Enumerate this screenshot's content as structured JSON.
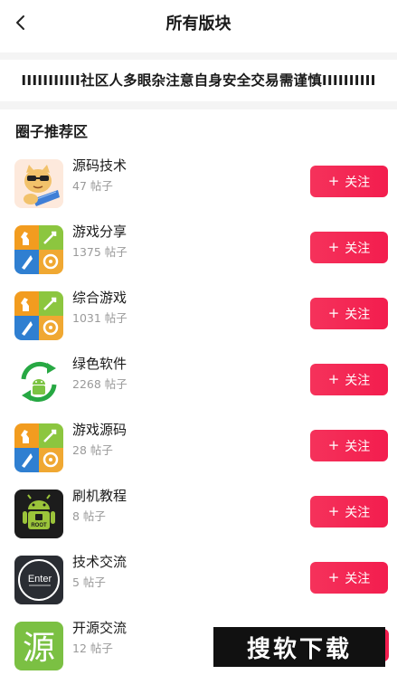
{
  "header": {
    "title": "所有版块",
    "back_icon": "chevron-left-icon"
  },
  "notice": {
    "text": "IIIIIIIIIII社区人多眼杂注意自身安全交易需谨慎IIIIIIIIII"
  },
  "section": {
    "title": "圈子推荐区"
  },
  "follow_label": "关注",
  "follow_plus": "+",
  "boards": [
    {
      "name": "源码技术",
      "count": "47 帖子",
      "icon": "cartoon-cat-laptop-icon"
    },
    {
      "name": "游戏分享",
      "count": "1375 帖子",
      "icon": "game-tiles-icon"
    },
    {
      "name": "综合游戏",
      "count": "1031 帖子",
      "icon": "game-tiles-icon"
    },
    {
      "name": "绿色软件",
      "count": "2268 帖子",
      "icon": "android-recycle-icon"
    },
    {
      "name": "游戏源码",
      "count": "28 帖子",
      "icon": "game-tiles-icon"
    },
    {
      "name": "刷机教程",
      "count": "8 帖子",
      "icon": "android-root-icon"
    },
    {
      "name": "技术交流",
      "count": "5 帖子",
      "icon": "enter-circle-icon"
    },
    {
      "name": "开源交流",
      "count": "12 帖子",
      "icon": "yuan-character-icon"
    }
  ],
  "icon_text": {
    "root": "ROOT",
    "enter": "Enter",
    "yuan": "源"
  },
  "watermark": {
    "text": "搜软下载"
  },
  "colors": {
    "accent": "#f31d4e",
    "muted": "#9a9a9a",
    "divider": "#f4f4f4"
  }
}
